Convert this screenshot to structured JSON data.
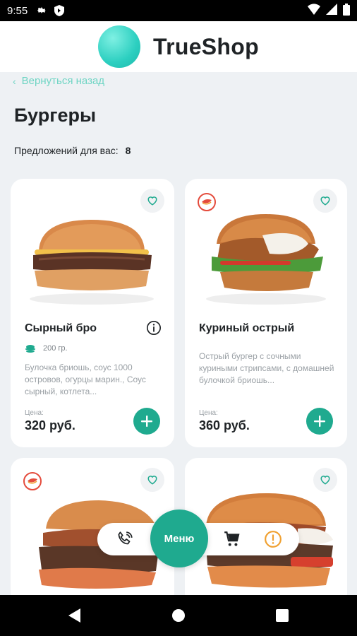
{
  "status_bar": {
    "time": "9:55"
  },
  "header": {
    "brand": "TrueShop"
  },
  "back_link": {
    "label": "Вернуться назад"
  },
  "page": {
    "title": "Бургеры",
    "offers_label": "Предложений для вас:",
    "offers_count": "8"
  },
  "products": [
    {
      "name": "Сырный бро",
      "weight": "200 гр.",
      "description": "Булочка бриошь, соус 1000 островов, огурцы марин., Соус сырный, котлета...",
      "price_label": "Цена:",
      "price": "320 руб."
    },
    {
      "name": "Куриный острый",
      "description": "Острый бургер с сочными куриными стрипсами, с домашней булочкой бриошь...",
      "price_label": "Цена:",
      "price": "360 руб."
    }
  ],
  "nav": {
    "menu_label": "Меню"
  },
  "icons": {
    "favorite": "heart-outline-icon",
    "add": "plus-icon",
    "info": "info-icon",
    "call": "phone-call-icon",
    "cart": "cart-icon",
    "alert": "alert-circle-icon",
    "spicy": "spicy-badge-icon"
  },
  "colors": {
    "accent": "#1faa8f",
    "back_link": "#6fd5c4",
    "spicy": "#e44b3c"
  }
}
